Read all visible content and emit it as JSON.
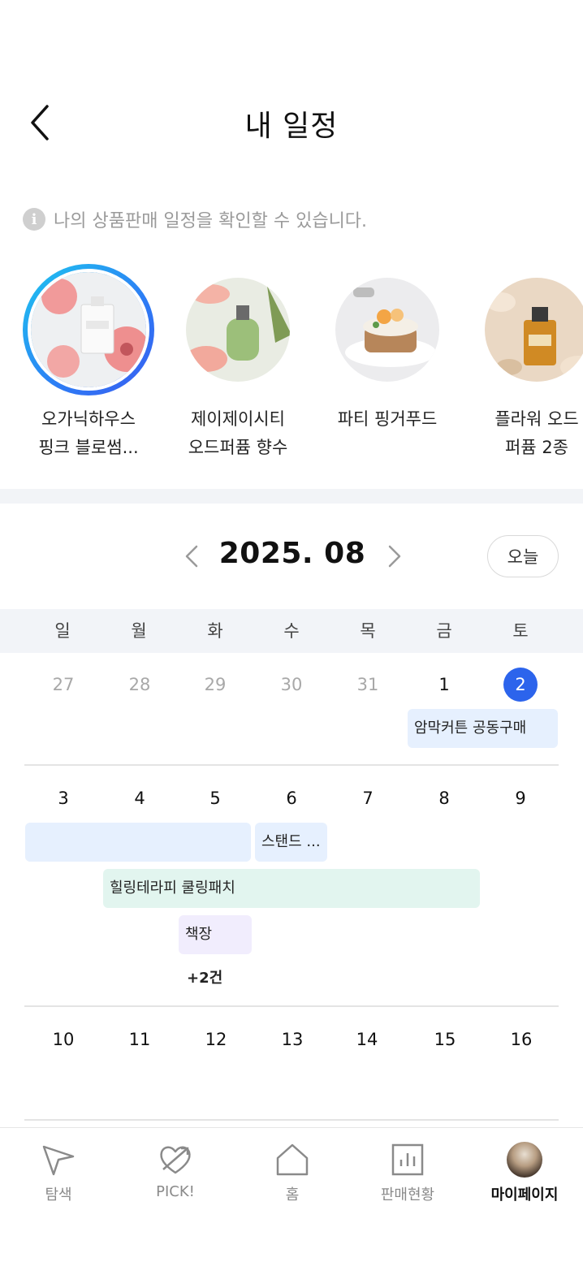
{
  "header": {
    "title": "내 일정",
    "back_icon": "chevron-left-icon"
  },
  "info": {
    "icon": "info-icon",
    "text": "나의 상품판매 일정을 확인할 수 있습니다."
  },
  "products": [
    {
      "name_line1": "오가닉하우스",
      "name_line2": "핑크 블로썸...",
      "selected": true,
      "image": "perfume-with-pink-flowers"
    },
    {
      "name_line1": "제이제이시티",
      "name_line2": "오드퍼퓸 향수",
      "selected": false,
      "image": "green-perfume-bottle"
    },
    {
      "name_line1": "파티 핑거푸드",
      "name_line2": "",
      "selected": false,
      "image": "finger-food-dish"
    },
    {
      "name_line1": "플라워 오드",
      "name_line2": "퍼퓸 2종",
      "selected": false,
      "image": "amber-perfume-bottle"
    }
  ],
  "calendar": {
    "month_label": "2025. 08",
    "today_button": "오늘",
    "weekdays": [
      "일",
      "월",
      "화",
      "수",
      "목",
      "금",
      "토"
    ],
    "week1": [
      "27",
      "28",
      "29",
      "30",
      "31",
      "1",
      "2"
    ],
    "week2": [
      "3",
      "4",
      "5",
      "6",
      "7",
      "8",
      "9"
    ],
    "week3": [
      "10",
      "11",
      "12",
      "13",
      "14",
      "15",
      "16"
    ],
    "events": {
      "e1": "암막커튼 공동구매",
      "e2": "",
      "e3": "스탠드 ...",
      "e4": "힐링테라피 쿨링패치",
      "e5": "책장"
    },
    "more": "+2건"
  },
  "tabbar": {
    "explore": "탐색",
    "pick": "PICK!",
    "home": "홈",
    "sales": "판매현황",
    "mypage": "마이페이지"
  },
  "colors": {
    "accent": "#2c64ec",
    "event_blue": "#e6f0fe",
    "event_green": "#e2f5ef",
    "event_purple": "#f1edfd"
  }
}
